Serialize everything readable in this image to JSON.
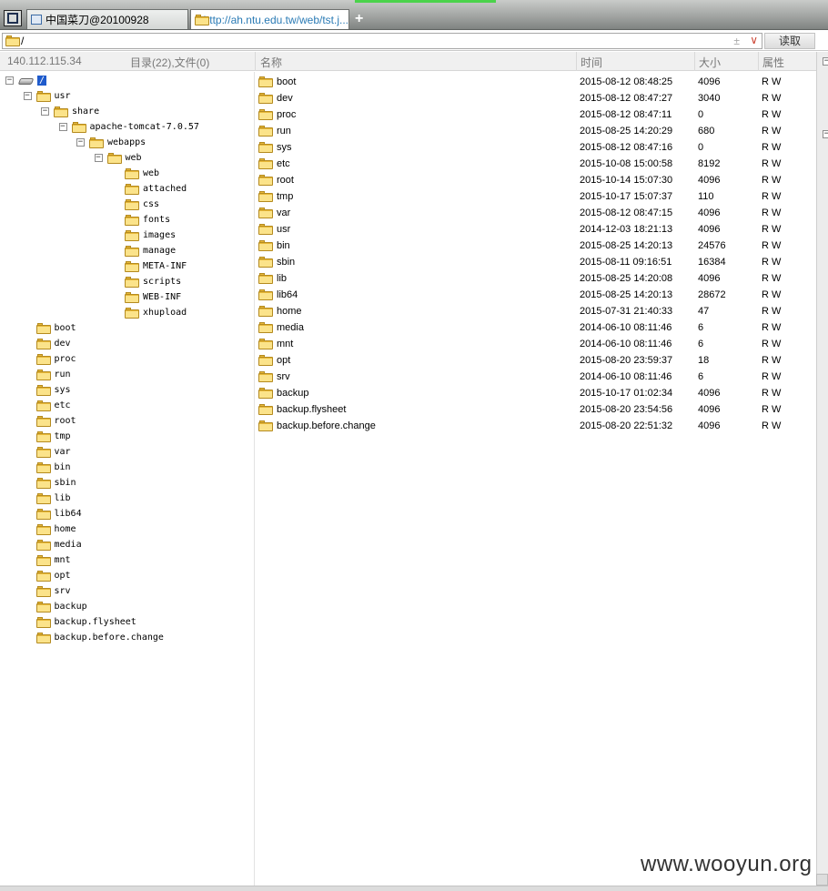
{
  "tabs": [
    {
      "title": "中国菜刀@20100928"
    },
    {
      "title": "http://ah.ntu.edu.tw/web/tst.j..."
    }
  ],
  "new_tab_label": "+",
  "address": {
    "value": "/",
    "extra": "±",
    "dropdown": "∨",
    "read_button": "读取"
  },
  "header": {
    "ip": "140.112.115.34",
    "summary": "目录(22),文件(0)",
    "columns": [
      "名称",
      "时间",
      "大小",
      "属性"
    ]
  },
  "tree": [
    {
      "label": "/",
      "depth": 0,
      "toggle": "−",
      "type": "drive",
      "selected": true
    },
    {
      "label": "usr",
      "depth": 1,
      "toggle": "−"
    },
    {
      "label": "share",
      "depth": 2,
      "toggle": "−"
    },
    {
      "label": "apache-tomcat-7.0.57",
      "depth": 3,
      "toggle": "−"
    },
    {
      "label": "webapps",
      "depth": 4,
      "toggle": "−"
    },
    {
      "label": "web",
      "depth": 5,
      "toggle": "−"
    },
    {
      "label": "web",
      "depth": 6
    },
    {
      "label": "attached",
      "depth": 6
    },
    {
      "label": "css",
      "depth": 6
    },
    {
      "label": "fonts",
      "depth": 6
    },
    {
      "label": "images",
      "depth": 6
    },
    {
      "label": "manage",
      "depth": 6
    },
    {
      "label": "META-INF",
      "depth": 6
    },
    {
      "label": "scripts",
      "depth": 6
    },
    {
      "label": "WEB-INF",
      "depth": 6
    },
    {
      "label": "xhupload",
      "depth": 6
    },
    {
      "label": "boot",
      "depth": 1
    },
    {
      "label": "dev",
      "depth": 1
    },
    {
      "label": "proc",
      "depth": 1
    },
    {
      "label": "run",
      "depth": 1
    },
    {
      "label": "sys",
      "depth": 1
    },
    {
      "label": "etc",
      "depth": 1
    },
    {
      "label": "root",
      "depth": 1
    },
    {
      "label": "tmp",
      "depth": 1
    },
    {
      "label": "var",
      "depth": 1
    },
    {
      "label": "bin",
      "depth": 1
    },
    {
      "label": "sbin",
      "depth": 1
    },
    {
      "label": "lib",
      "depth": 1
    },
    {
      "label": "lib64",
      "depth": 1
    },
    {
      "label": "home",
      "depth": 1
    },
    {
      "label": "media",
      "depth": 1
    },
    {
      "label": "mnt",
      "depth": 1
    },
    {
      "label": "opt",
      "depth": 1
    },
    {
      "label": "srv",
      "depth": 1
    },
    {
      "label": "backup",
      "depth": 1
    },
    {
      "label": "backup.flysheet",
      "depth": 1
    },
    {
      "label": "backup.before.change",
      "depth": 1
    }
  ],
  "files": [
    {
      "name": "boot",
      "time": "2015-08-12 08:48:25",
      "size": "4096",
      "attr": "R W"
    },
    {
      "name": "dev",
      "time": "2015-08-12 08:47:27",
      "size": "3040",
      "attr": "R W"
    },
    {
      "name": "proc",
      "time": "2015-08-12 08:47:11",
      "size": "0",
      "attr": "R W"
    },
    {
      "name": "run",
      "time": "2015-08-25 14:20:29",
      "size": "680",
      "attr": "R W"
    },
    {
      "name": "sys",
      "time": "2015-08-12 08:47:16",
      "size": "0",
      "attr": "R W"
    },
    {
      "name": "etc",
      "time": "2015-10-08 15:00:58",
      "size": "8192",
      "attr": "R W"
    },
    {
      "name": "root",
      "time": "2015-10-14 15:07:30",
      "size": "4096",
      "attr": "R W"
    },
    {
      "name": "tmp",
      "time": "2015-10-17 15:07:37",
      "size": "110",
      "attr": "R W"
    },
    {
      "name": "var",
      "time": "2015-08-12 08:47:15",
      "size": "4096",
      "attr": "R W"
    },
    {
      "name": "usr",
      "time": "2014-12-03 18:21:13",
      "size": "4096",
      "attr": "R W"
    },
    {
      "name": "bin",
      "time": "2015-08-25 14:20:13",
      "size": "24576",
      "attr": "R W"
    },
    {
      "name": "sbin",
      "time": "2015-08-11 09:16:51",
      "size": "16384",
      "attr": "R W"
    },
    {
      "name": "lib",
      "time": "2015-08-25 14:20:08",
      "size": "4096",
      "attr": "R W"
    },
    {
      "name": "lib64",
      "time": "2015-08-25 14:20:13",
      "size": "28672",
      "attr": "R W"
    },
    {
      "name": "home",
      "time": "2015-07-31 21:40:33",
      "size": "47",
      "attr": "R W"
    },
    {
      "name": "media",
      "time": "2014-06-10 08:11:46",
      "size": "6",
      "attr": "R W"
    },
    {
      "name": "mnt",
      "time": "2014-06-10 08:11:46",
      "size": "6",
      "attr": "R W"
    },
    {
      "name": "opt",
      "time": "2015-08-20 23:59:37",
      "size": "18",
      "attr": "R W"
    },
    {
      "name": "srv",
      "time": "2014-06-10 08:11:46",
      "size": "6",
      "attr": "R W"
    },
    {
      "name": "backup",
      "time": "2015-10-17 01:02:34",
      "size": "4096",
      "attr": "R W"
    },
    {
      "name": "backup.flysheet",
      "time": "2015-08-20 23:54:56",
      "size": "4096",
      "attr": "R W"
    },
    {
      "name": "backup.before.change",
      "time": "2015-08-20 22:51:32",
      "size": "4096",
      "attr": "R W"
    }
  ],
  "right_panel_toggles": [
    "−",
    "−"
  ],
  "watermark": "www.wooyun.org"
}
